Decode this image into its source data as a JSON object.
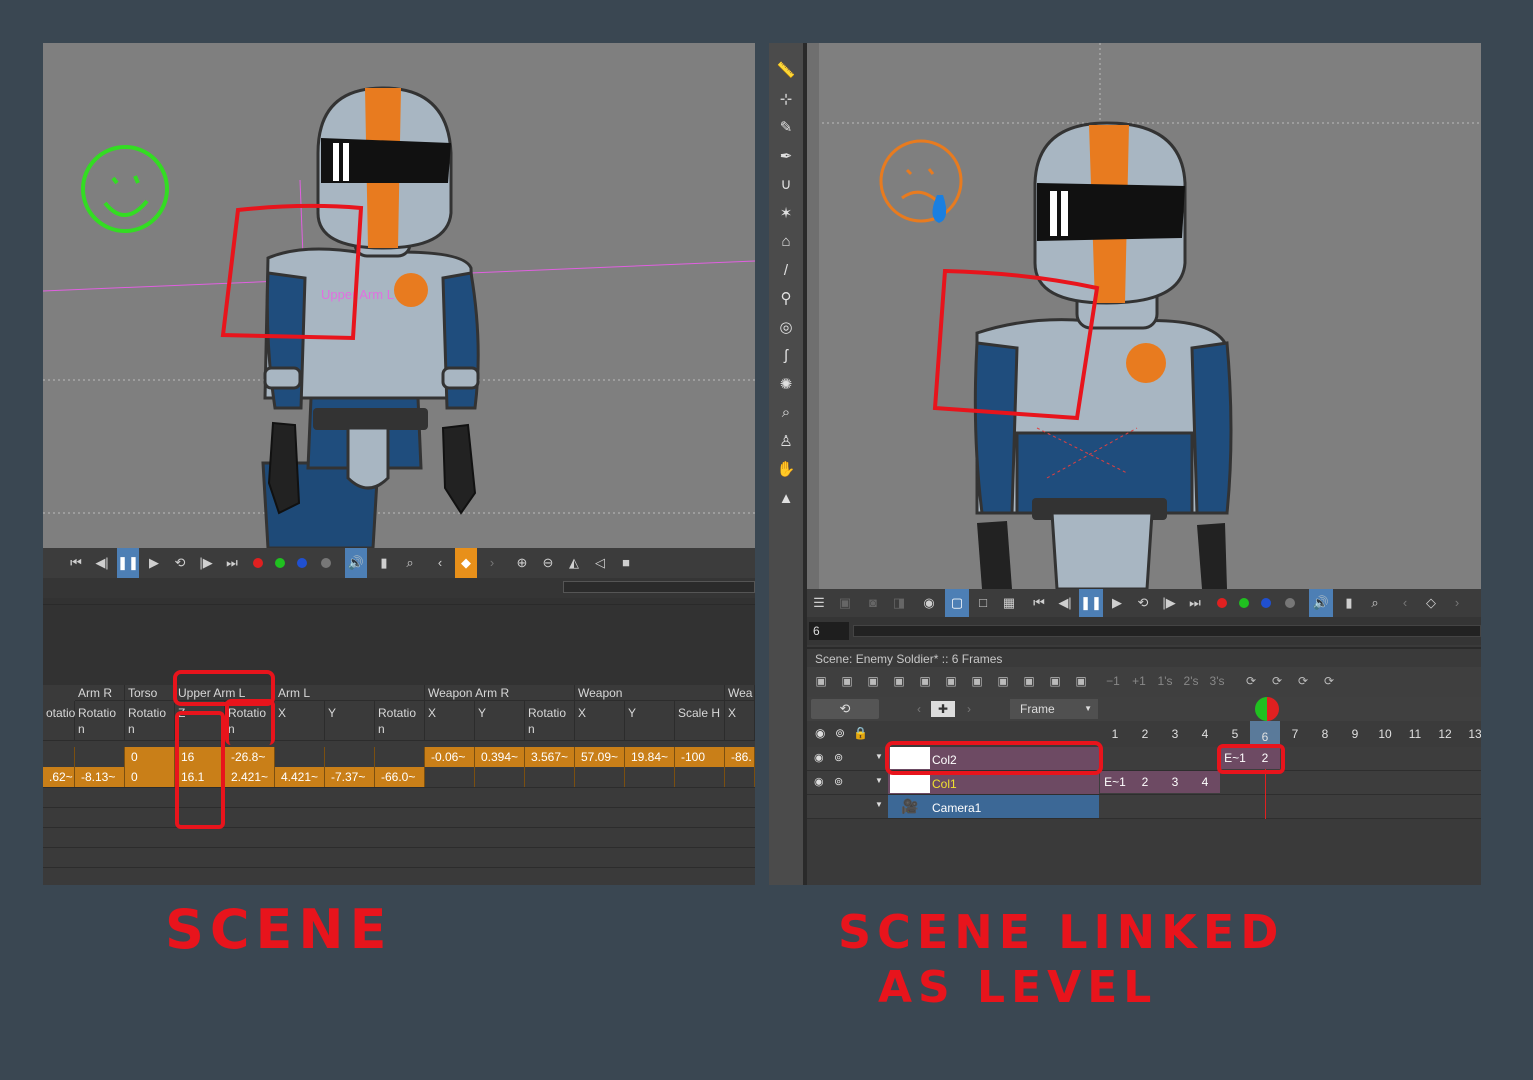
{
  "annotations": {
    "left_label": "SCENE",
    "right_label_line1": "SCENE LINKED",
    "right_label_line2": "AS LEVEL"
  },
  "colors": {
    "accent": "#4d7fb5",
    "keyframe": "#c97f18",
    "annotation": "#e8141c",
    "layer_selected": "#6d4a63",
    "camera_layer": "#3c6896"
  },
  "left": {
    "viewer": {
      "overlay_text": "Upper Arm L"
    },
    "transport_icons": [
      "first-frame-icon",
      "prev-frame-icon",
      "pause-icon",
      "play-icon",
      "loop-icon",
      "next-frame-icon",
      "last-frame-icon",
      "red-channel-icon",
      "green-channel-icon",
      "blue-channel-icon",
      "alpha-channel-icon",
      "sound-icon",
      "histogram-icon",
      "zoom-icon",
      "prev-key-icon",
      "key-icon",
      "next-key-icon",
      "zoom-in-icon",
      "zoom-out-icon",
      "flip-h-icon",
      "flip-v-icon",
      "reset-icon"
    ],
    "xsheet": {
      "groups": [
        "Arm R",
        "Torso",
        "Upper Arm L",
        "Arm L",
        "Weapon Arm R",
        "Weapon",
        "Wea"
      ],
      "columns": [
        {
          "h1": "",
          "h2a": "otatio",
          "h2b": "",
          "r1": "",
          "r2": ".62~"
        },
        {
          "h1": "Arm R",
          "h2a": "Rotatio",
          "h2b": "n",
          "r1": "",
          "r2": "-8.13~"
        },
        {
          "h1": "Torso",
          "h2a": "Rotatio",
          "h2b": "n",
          "r1": "0",
          "r2": "0"
        },
        {
          "h1": "Upper Arm L",
          "h2a": "Z",
          "h2b": "",
          "r1": "16",
          "r2": "16.1"
        },
        {
          "h1": "",
          "h2a": "Rotatio",
          "h2b": "n",
          "r1": "-26.8~",
          "r2": "2.421~"
        },
        {
          "h1": "Arm L",
          "h2a": "X",
          "h2b": "",
          "r1": "",
          "r2": "4.421~"
        },
        {
          "h1": "",
          "h2a": "Y",
          "h2b": "",
          "r1": "",
          "r2": "-7.37~"
        },
        {
          "h1": "",
          "h2a": "Rotatio",
          "h2b": "n",
          "r1": "",
          "r2": "-66.0~"
        },
        {
          "h1": "Weapon Arm R",
          "h2a": "X",
          "h2b": "",
          "r1": "-0.06~",
          "r2": ""
        },
        {
          "h1": "",
          "h2a": "Y",
          "h2b": "",
          "r1": "0.394~",
          "r2": ""
        },
        {
          "h1": "",
          "h2a": "Rotatio",
          "h2b": "n",
          "r1": "3.567~",
          "r2": ""
        },
        {
          "h1": "Weapon",
          "h2a": "X",
          "h2b": "",
          "r1": "57.09~",
          "r2": ""
        },
        {
          "h1": "",
          "h2a": "Y",
          "h2b": "",
          "r1": "19.84~",
          "r2": ""
        },
        {
          "h1": "",
          "h2a": "Scale H",
          "h2b": "",
          "r1": "-100",
          "r2": ""
        },
        {
          "h1": "Wea",
          "h2a": "X",
          "h2b": "",
          "r1": "-86.",
          "r2": ""
        }
      ]
    }
  },
  "right": {
    "tool_icons": [
      "ruler-icon",
      "animate-tool-icon",
      "brush-icon",
      "pen-icon",
      "magnet-icon",
      "skeleton-icon",
      "iron-icon",
      "knife-icon",
      "bone-icon",
      "target-icon",
      "hook-icon",
      "plastic-icon",
      "zoom-icon",
      "rotate-icon",
      "hand-icon",
      "collapse-icon"
    ],
    "frame_field": "6",
    "scene_header": "Scene: Enemy Soldier*  ::  6 Frames",
    "frame_mode": "Frame",
    "frame_numbers": [
      "1",
      "2",
      "3",
      "4",
      "5",
      "6",
      "7",
      "8",
      "9",
      "10",
      "11",
      "12",
      "13"
    ],
    "xsheet_tools": [
      "−1",
      "+1",
      "1's",
      "2's",
      "3's"
    ],
    "layers": [
      {
        "name": "Col2",
        "cells": [
          "",
          "",
          "",
          "",
          "E~1",
          "2"
        ]
      },
      {
        "name": "Col1",
        "cells": [
          "E~1",
          "2",
          "3",
          "4",
          "",
          ""
        ]
      },
      {
        "name": "Camera1",
        "cells": []
      }
    ]
  }
}
